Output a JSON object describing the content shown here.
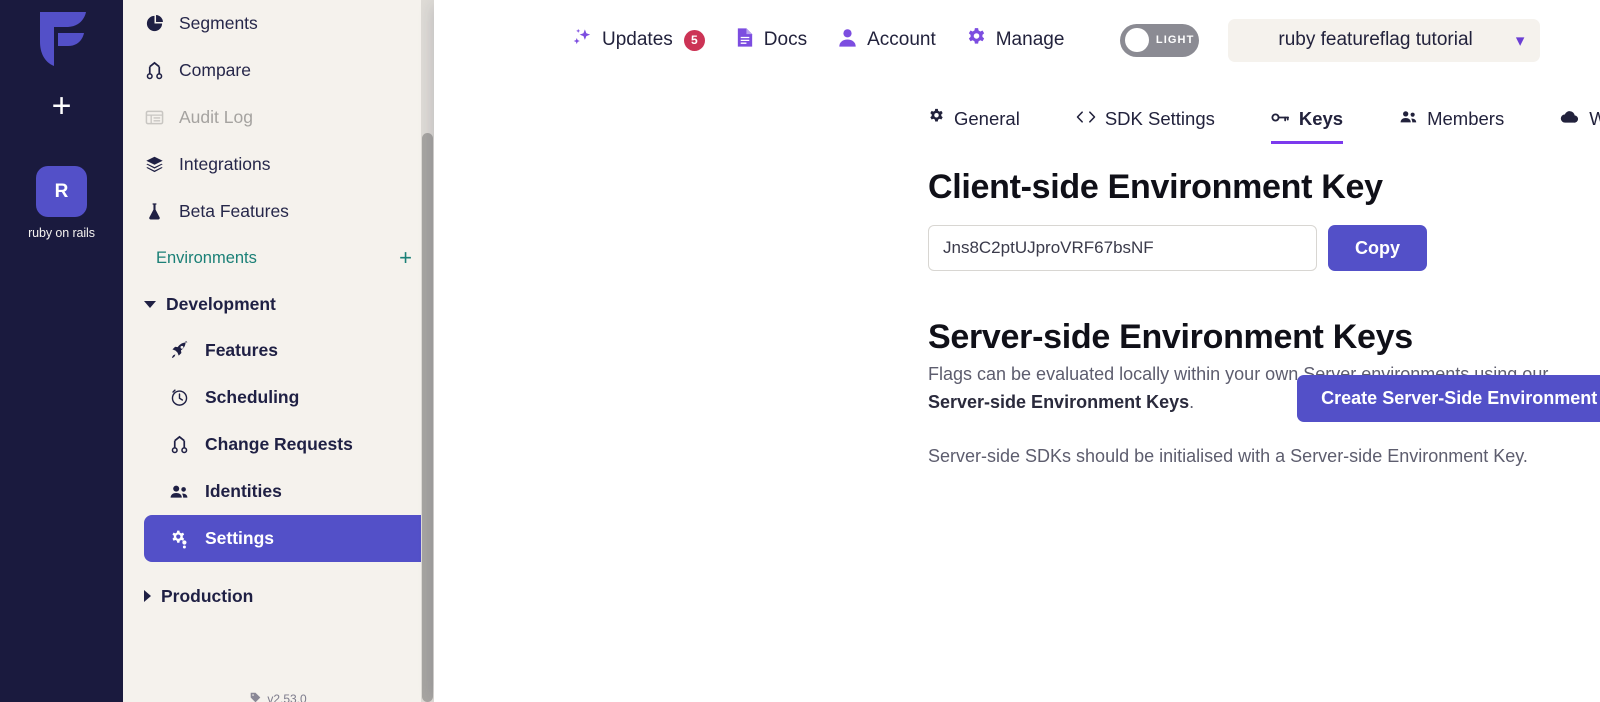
{
  "rail": {
    "logo_icon": "flagsmith-logo-icon",
    "add_label": "+",
    "project_initial": "R",
    "project_name": "ruby on rails"
  },
  "sidebar": {
    "nav_items": [
      {
        "label": "Segments",
        "icon": "pie-chart-icon",
        "disabled": false
      },
      {
        "label": "Compare",
        "icon": "compare-branch-icon",
        "disabled": false
      },
      {
        "label": "Audit Log",
        "icon": "list-table-icon",
        "disabled": true
      },
      {
        "label": "Integrations",
        "icon": "layers-icon",
        "disabled": false
      },
      {
        "label": "Beta Features",
        "icon": "flask-icon",
        "disabled": false
      }
    ],
    "environments_label": "Environments",
    "environments_add": "+",
    "groups": [
      {
        "label": "Development",
        "expanded": true,
        "items": [
          {
            "label": "Features",
            "icon": "rocket-icon",
            "active": false
          },
          {
            "label": "Scheduling",
            "icon": "clock-icon",
            "active": false
          },
          {
            "label": "Change Requests",
            "icon": "compare-branch-icon",
            "active": false
          },
          {
            "label": "Identities",
            "icon": "users-icon",
            "active": false
          },
          {
            "label": "Settings",
            "icon": "gears-icon",
            "active": true
          }
        ]
      },
      {
        "label": "Production",
        "expanded": false,
        "items": []
      }
    ],
    "version": "v2.53.0",
    "version_icon": "tag-icon"
  },
  "topbar": {
    "links": [
      {
        "label": "Updates",
        "icon": "sparkles-icon",
        "badge": "5"
      },
      {
        "label": "Docs",
        "icon": "document-icon",
        "badge": null
      },
      {
        "label": "Account",
        "icon": "person-icon",
        "badge": null
      },
      {
        "label": "Manage",
        "icon": "gear-icon",
        "badge": null
      }
    ],
    "theme_toggle_label": "LIGHT",
    "org_name": "ruby featureflag tutorial",
    "org_chevron_icon": "chevron-down-icon"
  },
  "tabs": [
    {
      "label": "General",
      "icon": "gear-icon",
      "active": false
    },
    {
      "label": "SDK Settings",
      "icon": "code-brackets-icon",
      "active": false
    },
    {
      "label": "Keys",
      "icon": "key-icon",
      "active": true
    },
    {
      "label": "Members",
      "icon": "users-icon",
      "active": false
    },
    {
      "label": "Webhooks",
      "icon": "cloud-icon",
      "active": false
    }
  ],
  "client_key": {
    "title": "Client-side Environment Key",
    "value": "Jns8C2ptUJproVRF67bsNF",
    "copy_label": "Copy"
  },
  "server_keys": {
    "title": "Server-side Environment Keys",
    "paragraph1_prefix": "Flags can be evaluated locally within your own Server environments using our ",
    "paragraph1_bold": "Server-side Environment Keys",
    "paragraph1_suffix": ".",
    "paragraph2": "Server-side SDKs should be initialised with a Server-side Environment Key.",
    "create_button_label": "Create Server-Side Environment Key"
  },
  "chat": {
    "icon": "chat-bubble-icon"
  },
  "colors": {
    "rail_bg": "#1a1a3e",
    "sidebar_bg": "#f5f2ed",
    "accent": "#5350c8",
    "tab_underline": "#7c3aed",
    "teal": "#1b8077",
    "badge_red": "#cc3355",
    "chat_purple": "#7b2ff2"
  }
}
